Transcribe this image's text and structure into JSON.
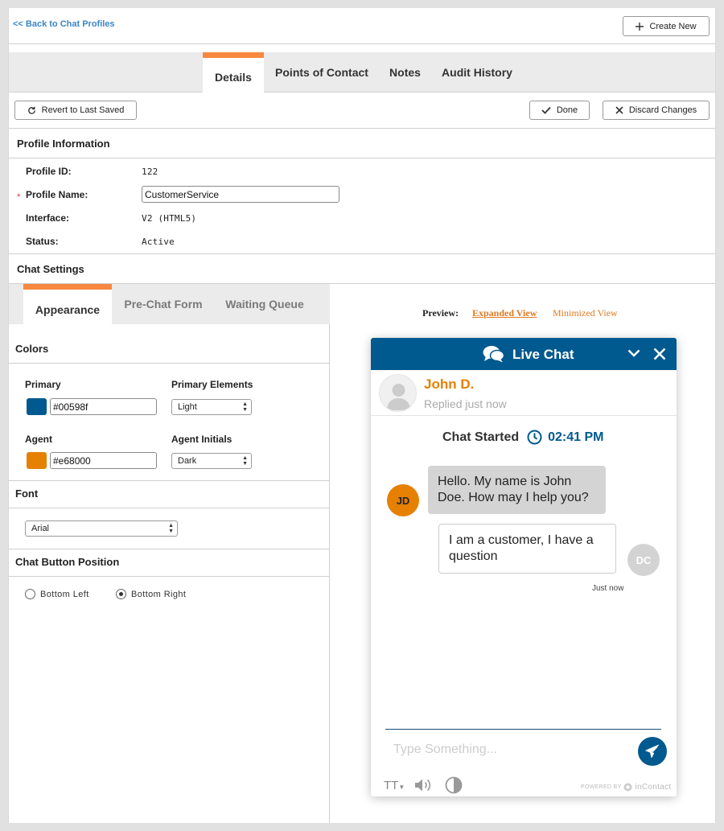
{
  "nav": {
    "back_label": "<< Back to Chat Profiles",
    "create_label": "Create New"
  },
  "tabs": [
    {
      "label": "Details",
      "active": true
    },
    {
      "label": "Points of Contact",
      "active": false
    },
    {
      "label": "Notes",
      "active": false
    },
    {
      "label": "Audit History",
      "active": false
    }
  ],
  "actions": {
    "revert_label": "Revert to Last Saved",
    "done_label": "Done",
    "discard_label": "Discard Changes"
  },
  "profile": {
    "section_title": "Profile Information",
    "fields": {
      "id_label": "Profile ID:",
      "id_value": "122",
      "name_label": "Profile Name:",
      "name_value": "CustomerService",
      "required_mark": "*",
      "interface_label": "Interface:",
      "interface_value": "V2 (HTML5)",
      "status_label": "Status:",
      "status_value": "Active"
    }
  },
  "chat_settings": {
    "section_title": "Chat Settings",
    "subtabs": [
      {
        "label": "Appearance",
        "active": true
      },
      {
        "label": "Pre-Chat Form",
        "active": false
      },
      {
        "label": "Waiting Queue",
        "active": false
      }
    ],
    "colors": {
      "section_title": "Colors",
      "primary_label": "Primary",
      "primary_value": "#00598f",
      "primary_elements_label": "Primary Elements",
      "primary_elements_value": "Light",
      "agent_label": "Agent",
      "agent_value": "#e68000",
      "agent_initials_label": "Agent Initials",
      "agent_initials_value": "Dark"
    },
    "font": {
      "section_title": "Font",
      "value": "Arial"
    },
    "button_position": {
      "section_title": "Chat Button Position",
      "options": [
        {
          "label": "Bottom Left",
          "selected": false
        },
        {
          "label": "Bottom Right",
          "selected": true
        }
      ]
    }
  },
  "preview": {
    "label": "Preview:",
    "expanded_label": "Expanded View",
    "minimized_label": "Minimized View",
    "widget": {
      "title": "Live Chat",
      "agent_name": "John D.",
      "agent_status": "Replied just now",
      "started_label": "Chat Started",
      "started_time": "02:41 PM",
      "agent_message": "Hello. My name is John Doe. How may I help you?",
      "agent_initials": "JD",
      "customer_message": "I am a customer, I have a question",
      "customer_initials": "DC",
      "message_time": "Just now",
      "input_placeholder": "Type Something...",
      "text_size_label": "TT",
      "powered_prefix": "POWERED BY",
      "powered_brand": "inContact"
    }
  },
  "colors": {
    "accent": "#f7883f",
    "primary": "#00598f",
    "agent": "#e68000",
    "link": "#3a86c8"
  }
}
